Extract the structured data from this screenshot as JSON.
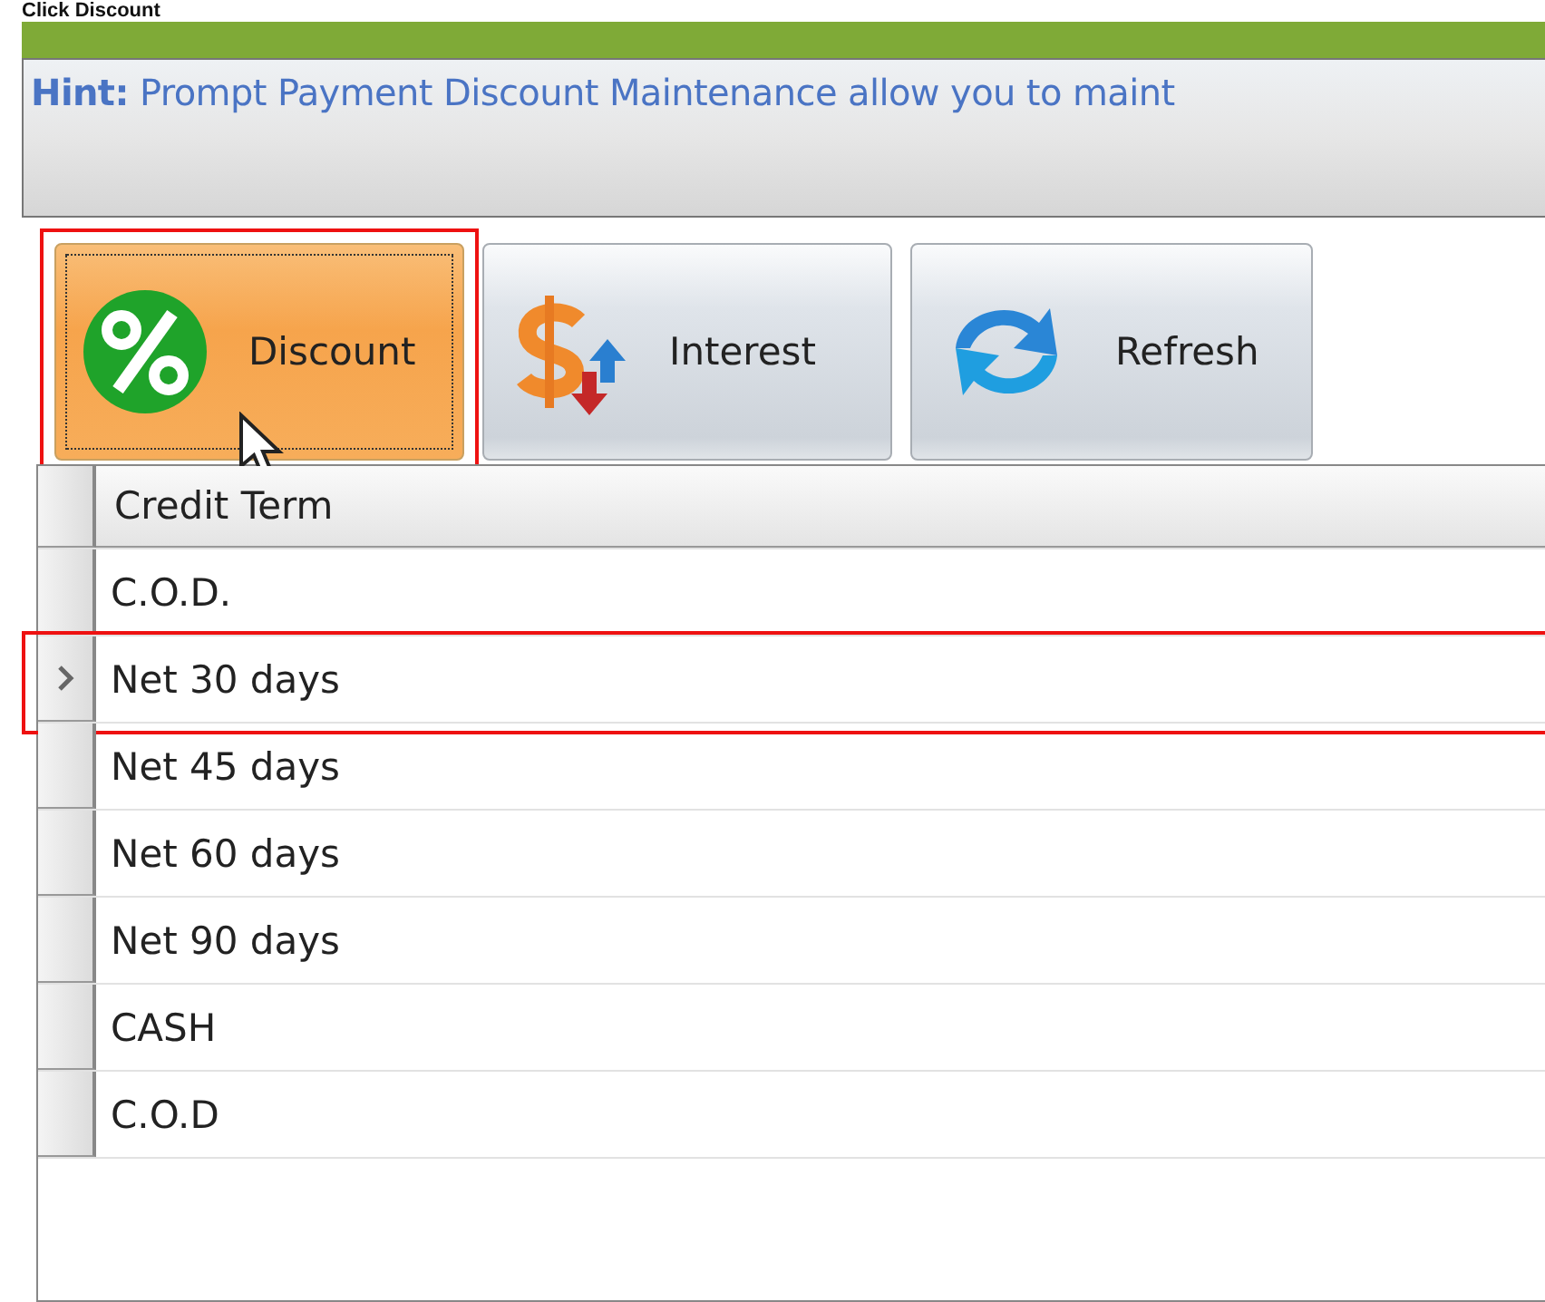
{
  "heading": "Click Discount",
  "hint": {
    "label": "Hint:",
    "text": "Prompt Payment Discount Maintenance allow you to maint"
  },
  "toolbar": [
    {
      "kind": "percent",
      "label": "Discount",
      "selected": true
    },
    {
      "kind": "interest",
      "label": "Interest",
      "selected": false
    },
    {
      "kind": "refresh",
      "label": "Refresh",
      "selected": false
    }
  ],
  "table": {
    "columns": [
      "Credit Term"
    ],
    "rows": [
      {
        "cells": [
          "C.O.D."
        ],
        "selected": false
      },
      {
        "cells": [
          "Net 30 days"
        ],
        "selected": true
      },
      {
        "cells": [
          "Net 45 days"
        ],
        "selected": false
      },
      {
        "cells": [
          "Net 60 days"
        ],
        "selected": false
      },
      {
        "cells": [
          "Net 90 days"
        ],
        "selected": false
      },
      {
        "cells": [
          "CASH"
        ],
        "selected": false
      },
      {
        "cells": [
          "C.O.D"
        ],
        "selected": false
      }
    ]
  }
}
